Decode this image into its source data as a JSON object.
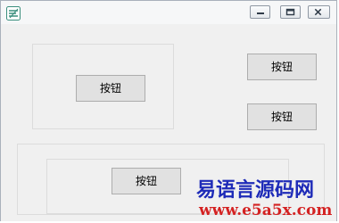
{
  "window": {
    "icon": "app-icon",
    "controls": {
      "minimize_icon": "minimize-icon",
      "maximize_icon": "maximize-icon",
      "close_icon": "close-icon"
    }
  },
  "buttons": {
    "left": "按钮",
    "right_top": "按钮",
    "right_mid": "按钮",
    "bottom": "按钮"
  },
  "watermark": {
    "title": "易语言源码网",
    "url": "www.e5a5x.com"
  }
}
